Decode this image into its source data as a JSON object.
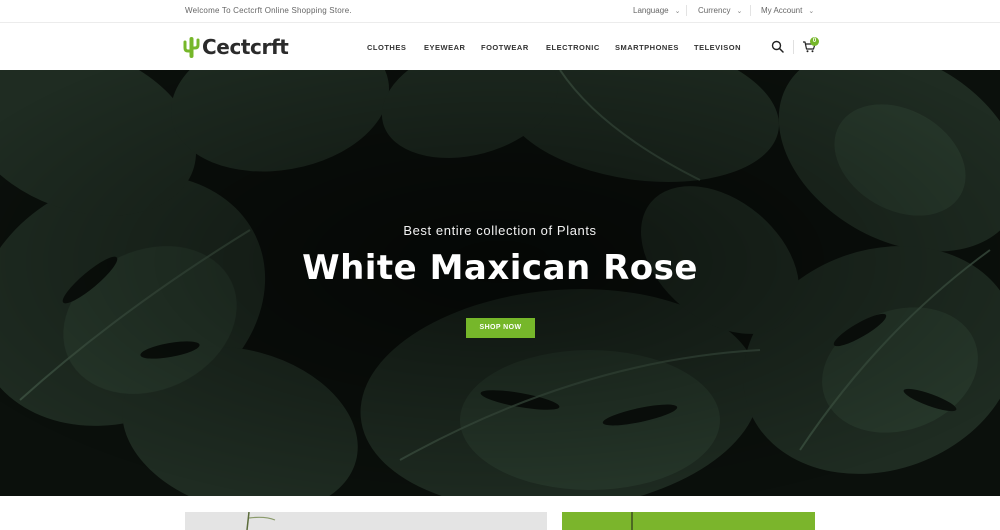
{
  "topbar": {
    "welcome": "Welcome To Cectcrft Online Shopping Store.",
    "language": "Language",
    "currency": "Currency",
    "account": "My Account"
  },
  "header": {
    "logo": "Cectcrft",
    "nav": [
      "CLOTHES",
      "EYEWEAR",
      "FOOTWEAR",
      "ELECTRONIC",
      "SMARTPHONES",
      "TELEVISON"
    ],
    "cart_count": "0"
  },
  "hero": {
    "subtitle": "Best entire collection of Plants",
    "title": "White Maxican Rose",
    "button": "SHOP NOW"
  },
  "colors": {
    "accent": "#76b72a",
    "hero_bg": "#0d120e",
    "leaf": "#26352a"
  },
  "icons": [
    "cactus-icon",
    "chevron-down-icon",
    "search-icon",
    "cart-icon"
  ]
}
